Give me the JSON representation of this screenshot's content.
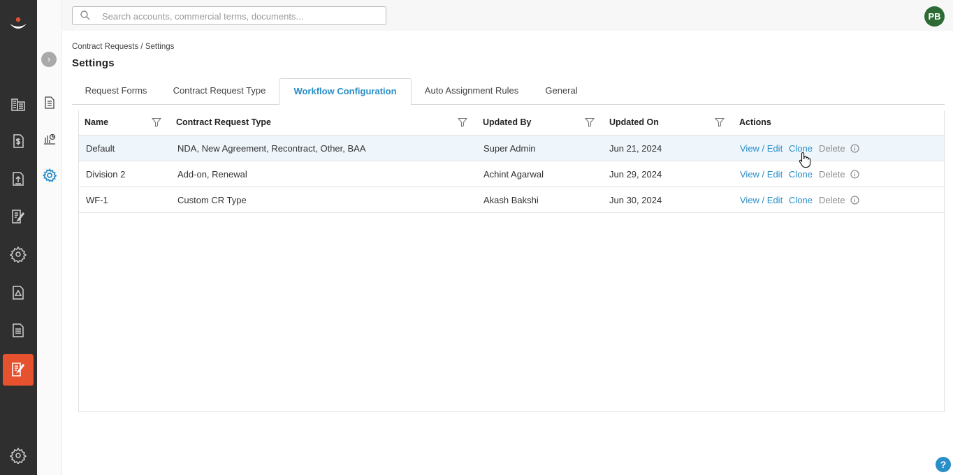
{
  "search": {
    "placeholder": "Search accounts, commercial terms, documents..."
  },
  "user": {
    "initials": "PB",
    "avatar_color": "#2e6b34"
  },
  "rail": {
    "icons": [
      "logo",
      "buildings-icon",
      "dollar-doc-icon",
      "upload-doc-icon",
      "edit-doc-icon",
      "settings-gear-icon",
      "alert-doc-icon",
      "report-doc-icon",
      "contract-request-icon",
      "admin-gear-icon"
    ],
    "active_item": "contract-request-icon",
    "active_color": "#e7522e"
  },
  "side2": {
    "icons": [
      "expand-chevron-icon",
      "document-icon",
      "chart-icon",
      "settings-icon"
    ]
  },
  "breadcrumb": "Contract Requests / Settings",
  "page_title": "Settings",
  "tabs": [
    {
      "label": "Request Forms"
    },
    {
      "label": "Contract Request Type"
    },
    {
      "label": "Workflow Configuration"
    },
    {
      "label": "Auto Assignment Rules"
    },
    {
      "label": "General"
    }
  ],
  "active_tab": "Workflow Configuration",
  "table": {
    "columns": [
      "Name",
      "Contract Request Type",
      "Updated By",
      "Updated On",
      "Actions"
    ],
    "rows": [
      {
        "name": "Default",
        "type": "NDA, New Agreement, Recontract, Other, BAA",
        "updated_by": "Super Admin",
        "updated_on": "Jun 21, 2024"
      },
      {
        "name": "Division 2",
        "type": "Add-on, Renewal",
        "updated_by": "Achint Agarwal",
        "updated_on": "Jun 29, 2024"
      },
      {
        "name": "WF-1",
        "type": "Custom CR Type",
        "updated_by": "Akash Bakshi",
        "updated_on": "Jun 30, 2024"
      }
    ],
    "actions": {
      "view": "View / Edit",
      "clone": "Clone",
      "delete": "Delete"
    }
  },
  "help": "?",
  "colors": {
    "link": "#2a8ec8",
    "highlight_row": "#eef5fb"
  }
}
